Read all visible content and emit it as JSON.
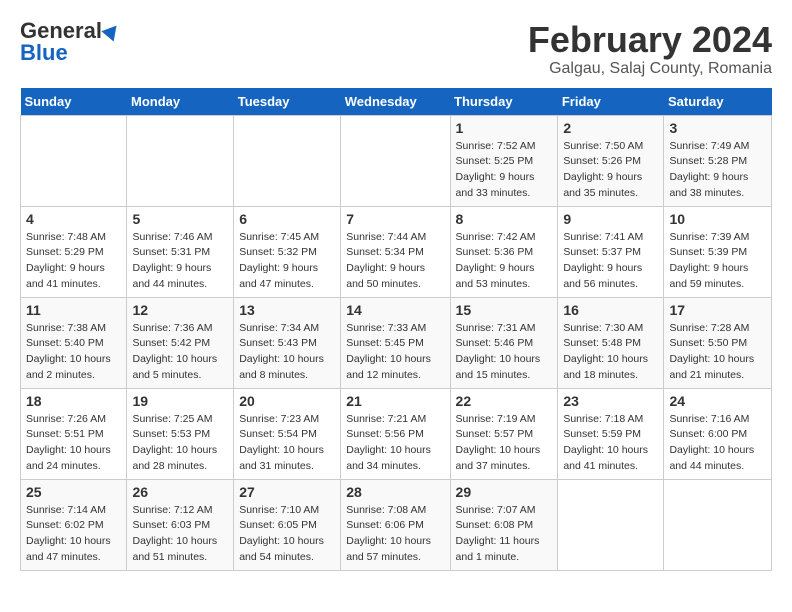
{
  "header": {
    "logo_general": "General",
    "logo_blue": "Blue",
    "title": "February 2024",
    "subtitle": "Galgau, Salaj County, Romania"
  },
  "weekdays": [
    "Sunday",
    "Monday",
    "Tuesday",
    "Wednesday",
    "Thursday",
    "Friday",
    "Saturday"
  ],
  "weeks": [
    [
      {
        "day": "",
        "info": ""
      },
      {
        "day": "",
        "info": ""
      },
      {
        "day": "",
        "info": ""
      },
      {
        "day": "",
        "info": ""
      },
      {
        "day": "1",
        "info": "Sunrise: 7:52 AM\nSunset: 5:25 PM\nDaylight: 9 hours\nand 33 minutes."
      },
      {
        "day": "2",
        "info": "Sunrise: 7:50 AM\nSunset: 5:26 PM\nDaylight: 9 hours\nand 35 minutes."
      },
      {
        "day": "3",
        "info": "Sunrise: 7:49 AM\nSunset: 5:28 PM\nDaylight: 9 hours\nand 38 minutes."
      }
    ],
    [
      {
        "day": "4",
        "info": "Sunrise: 7:48 AM\nSunset: 5:29 PM\nDaylight: 9 hours\nand 41 minutes."
      },
      {
        "day": "5",
        "info": "Sunrise: 7:46 AM\nSunset: 5:31 PM\nDaylight: 9 hours\nand 44 minutes."
      },
      {
        "day": "6",
        "info": "Sunrise: 7:45 AM\nSunset: 5:32 PM\nDaylight: 9 hours\nand 47 minutes."
      },
      {
        "day": "7",
        "info": "Sunrise: 7:44 AM\nSunset: 5:34 PM\nDaylight: 9 hours\nand 50 minutes."
      },
      {
        "day": "8",
        "info": "Sunrise: 7:42 AM\nSunset: 5:36 PM\nDaylight: 9 hours\nand 53 minutes."
      },
      {
        "day": "9",
        "info": "Sunrise: 7:41 AM\nSunset: 5:37 PM\nDaylight: 9 hours\nand 56 minutes."
      },
      {
        "day": "10",
        "info": "Sunrise: 7:39 AM\nSunset: 5:39 PM\nDaylight: 9 hours\nand 59 minutes."
      }
    ],
    [
      {
        "day": "11",
        "info": "Sunrise: 7:38 AM\nSunset: 5:40 PM\nDaylight: 10 hours\nand 2 minutes."
      },
      {
        "day": "12",
        "info": "Sunrise: 7:36 AM\nSunset: 5:42 PM\nDaylight: 10 hours\nand 5 minutes."
      },
      {
        "day": "13",
        "info": "Sunrise: 7:34 AM\nSunset: 5:43 PM\nDaylight: 10 hours\nand 8 minutes."
      },
      {
        "day": "14",
        "info": "Sunrise: 7:33 AM\nSunset: 5:45 PM\nDaylight: 10 hours\nand 12 minutes."
      },
      {
        "day": "15",
        "info": "Sunrise: 7:31 AM\nSunset: 5:46 PM\nDaylight: 10 hours\nand 15 minutes."
      },
      {
        "day": "16",
        "info": "Sunrise: 7:30 AM\nSunset: 5:48 PM\nDaylight: 10 hours\nand 18 minutes."
      },
      {
        "day": "17",
        "info": "Sunrise: 7:28 AM\nSunset: 5:50 PM\nDaylight: 10 hours\nand 21 minutes."
      }
    ],
    [
      {
        "day": "18",
        "info": "Sunrise: 7:26 AM\nSunset: 5:51 PM\nDaylight: 10 hours\nand 24 minutes."
      },
      {
        "day": "19",
        "info": "Sunrise: 7:25 AM\nSunset: 5:53 PM\nDaylight: 10 hours\nand 28 minutes."
      },
      {
        "day": "20",
        "info": "Sunrise: 7:23 AM\nSunset: 5:54 PM\nDaylight: 10 hours\nand 31 minutes."
      },
      {
        "day": "21",
        "info": "Sunrise: 7:21 AM\nSunset: 5:56 PM\nDaylight: 10 hours\nand 34 minutes."
      },
      {
        "day": "22",
        "info": "Sunrise: 7:19 AM\nSunset: 5:57 PM\nDaylight: 10 hours\nand 37 minutes."
      },
      {
        "day": "23",
        "info": "Sunrise: 7:18 AM\nSunset: 5:59 PM\nDaylight: 10 hours\nand 41 minutes."
      },
      {
        "day": "24",
        "info": "Sunrise: 7:16 AM\nSunset: 6:00 PM\nDaylight: 10 hours\nand 44 minutes."
      }
    ],
    [
      {
        "day": "25",
        "info": "Sunrise: 7:14 AM\nSunset: 6:02 PM\nDaylight: 10 hours\nand 47 minutes."
      },
      {
        "day": "26",
        "info": "Sunrise: 7:12 AM\nSunset: 6:03 PM\nDaylight: 10 hours\nand 51 minutes."
      },
      {
        "day": "27",
        "info": "Sunrise: 7:10 AM\nSunset: 6:05 PM\nDaylight: 10 hours\nand 54 minutes."
      },
      {
        "day": "28",
        "info": "Sunrise: 7:08 AM\nSunset: 6:06 PM\nDaylight: 10 hours\nand 57 minutes."
      },
      {
        "day": "29",
        "info": "Sunrise: 7:07 AM\nSunset: 6:08 PM\nDaylight: 11 hours\nand 1 minute."
      },
      {
        "day": "",
        "info": ""
      },
      {
        "day": "",
        "info": ""
      }
    ]
  ]
}
